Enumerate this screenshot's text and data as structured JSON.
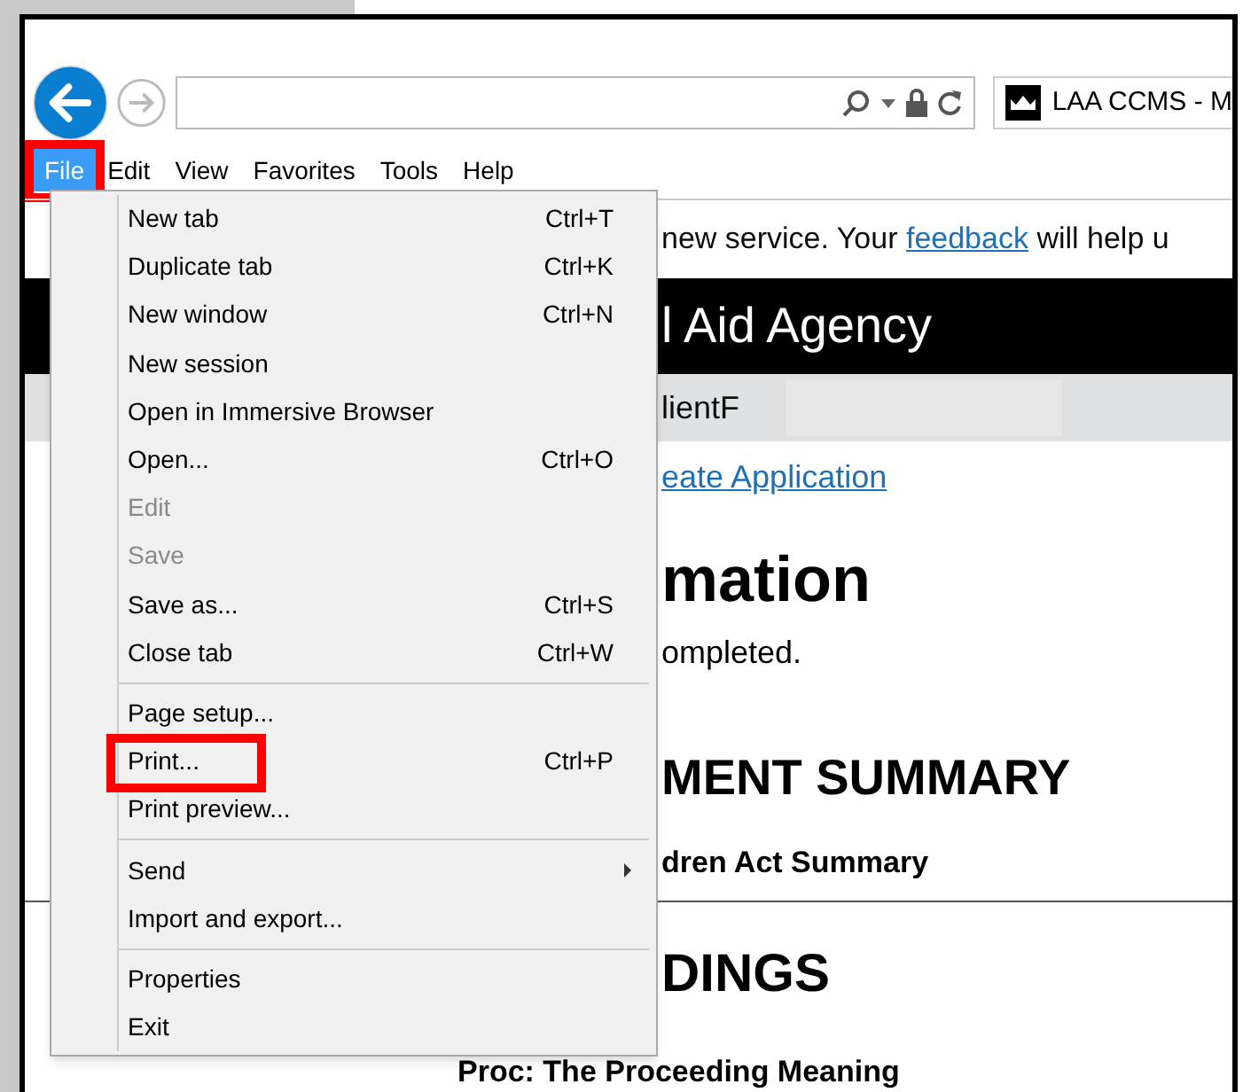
{
  "browser": {
    "tab": {
      "title": "LAA CCMS - M"
    },
    "menu_bar": [
      {
        "label": "File",
        "selected": true,
        "highlighted": true
      },
      {
        "label": "Edit",
        "selected": false,
        "highlighted": false
      },
      {
        "label": "View",
        "selected": false,
        "highlighted": false
      },
      {
        "label": "Favorites",
        "selected": false,
        "highlighted": false
      },
      {
        "label": "Tools",
        "selected": false,
        "highlighted": false
      },
      {
        "label": "Help",
        "selected": false,
        "highlighted": false
      }
    ]
  },
  "file_menu": {
    "groups": [
      [
        {
          "label": "New tab",
          "shortcut": "Ctrl+T",
          "disabled": false,
          "submenu": false,
          "highlighted": false
        },
        {
          "label": "Duplicate tab",
          "shortcut": "Ctrl+K",
          "disabled": false,
          "submenu": false,
          "highlighted": false
        },
        {
          "label": "New window",
          "shortcut": "Ctrl+N",
          "disabled": false,
          "submenu": false,
          "highlighted": false
        },
        {
          "label": "New session",
          "disabled": false,
          "submenu": false,
          "highlighted": false
        },
        {
          "label": "Open in Immersive Browser",
          "disabled": false,
          "submenu": false,
          "highlighted": false
        },
        {
          "label": "Open...",
          "shortcut": "Ctrl+O",
          "disabled": false,
          "submenu": false,
          "highlighted": false
        },
        {
          "label": "Edit",
          "disabled": true,
          "submenu": false,
          "highlighted": false
        },
        {
          "label": "Save",
          "disabled": true,
          "submenu": false,
          "highlighted": false
        },
        {
          "label": "Save as...",
          "shortcut": "Ctrl+S",
          "disabled": false,
          "submenu": false,
          "highlighted": false
        },
        {
          "label": "Close tab",
          "shortcut": "Ctrl+W",
          "disabled": false,
          "submenu": false,
          "highlighted": false
        }
      ],
      [
        {
          "label": "Page setup...",
          "disabled": false,
          "submenu": false,
          "highlighted": false
        },
        {
          "label": "Print...",
          "shortcut": "Ctrl+P",
          "disabled": false,
          "submenu": false,
          "highlighted": true
        },
        {
          "label": "Print preview...",
          "disabled": false,
          "submenu": false,
          "highlighted": false
        }
      ],
      [
        {
          "label": "Send",
          "disabled": false,
          "submenu": true,
          "highlighted": false
        },
        {
          "label": "Import and export...",
          "disabled": false,
          "submenu": false,
          "highlighted": false
        }
      ],
      [
        {
          "label": "Properties",
          "disabled": false,
          "submenu": false,
          "highlighted": false
        },
        {
          "label": "Exit",
          "disabled": false,
          "submenu": false,
          "highlighted": false
        }
      ]
    ]
  },
  "page": {
    "banner_text": {
      "before": "new service. Your ",
      "link": "feedback",
      "after": " will help u"
    },
    "header": "l Aid Agency",
    "client_bar": "lientF",
    "breadcrumb_link": "eate Application",
    "heading": "mation",
    "status_text": "ompleted.",
    "section_heading": "MENT SUMMARY",
    "subsection": "dren Act Summary",
    "section_heading_2": "DINGS",
    "proceeding": "Proc: The Proceeding Meaning"
  }
}
